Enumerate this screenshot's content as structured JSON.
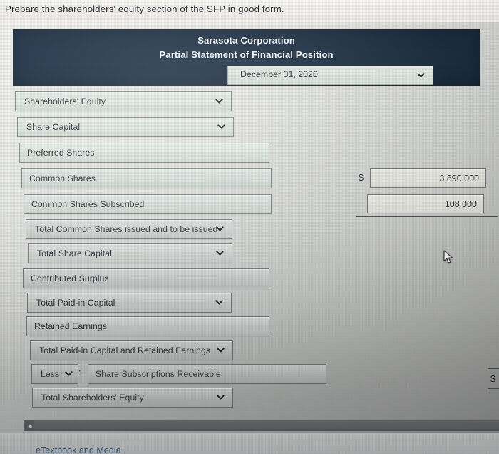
{
  "prompt": {
    "text": "Prepare the shareholders' equity section of the SFP in good form."
  },
  "statement_header": {
    "company": "Sarasota Corporation",
    "title": "Partial Statement of Financial Position",
    "date_select": {
      "value": "December 31, 2020",
      "chevron_icon": "chevron-down-icon"
    }
  },
  "rows": [
    {
      "label": "Shareholders' Equity",
      "kind": "select"
    },
    {
      "label": "Share Capital",
      "kind": "select"
    },
    {
      "label": "Preferred Shares",
      "kind": "text"
    },
    {
      "label": "Common Shares",
      "kind": "text"
    },
    {
      "label": "Common Shares Subscribed",
      "kind": "text"
    },
    {
      "label": "Total Common Shares issued and to be issued",
      "kind": "select"
    },
    {
      "label": "Total Share Capital",
      "kind": "select"
    },
    {
      "label": "Contributed Surplus",
      "kind": "text"
    },
    {
      "label": "Total Paid-in Capital",
      "kind": "select"
    },
    {
      "label": "Retained Earnings",
      "kind": "text"
    },
    {
      "label": "Total Paid-in Capital and Retained Earnings",
      "kind": "select"
    },
    {
      "label": "Less",
      "kind": "select",
      "separator": ":",
      "detail": "Share Subscriptions Receivable"
    },
    {
      "label": "Total Shareholders' Equity",
      "kind": "select"
    }
  ],
  "values": {
    "currency_symbol": "$",
    "common_shares": "3,890,000",
    "common_shares_subscribed": "108,000",
    "edge_currency_symbol": "$"
  },
  "scrollbar": {
    "left_arrow_icon": "◄"
  },
  "footer": {
    "etextbook_link": "eTextbook and Media"
  }
}
